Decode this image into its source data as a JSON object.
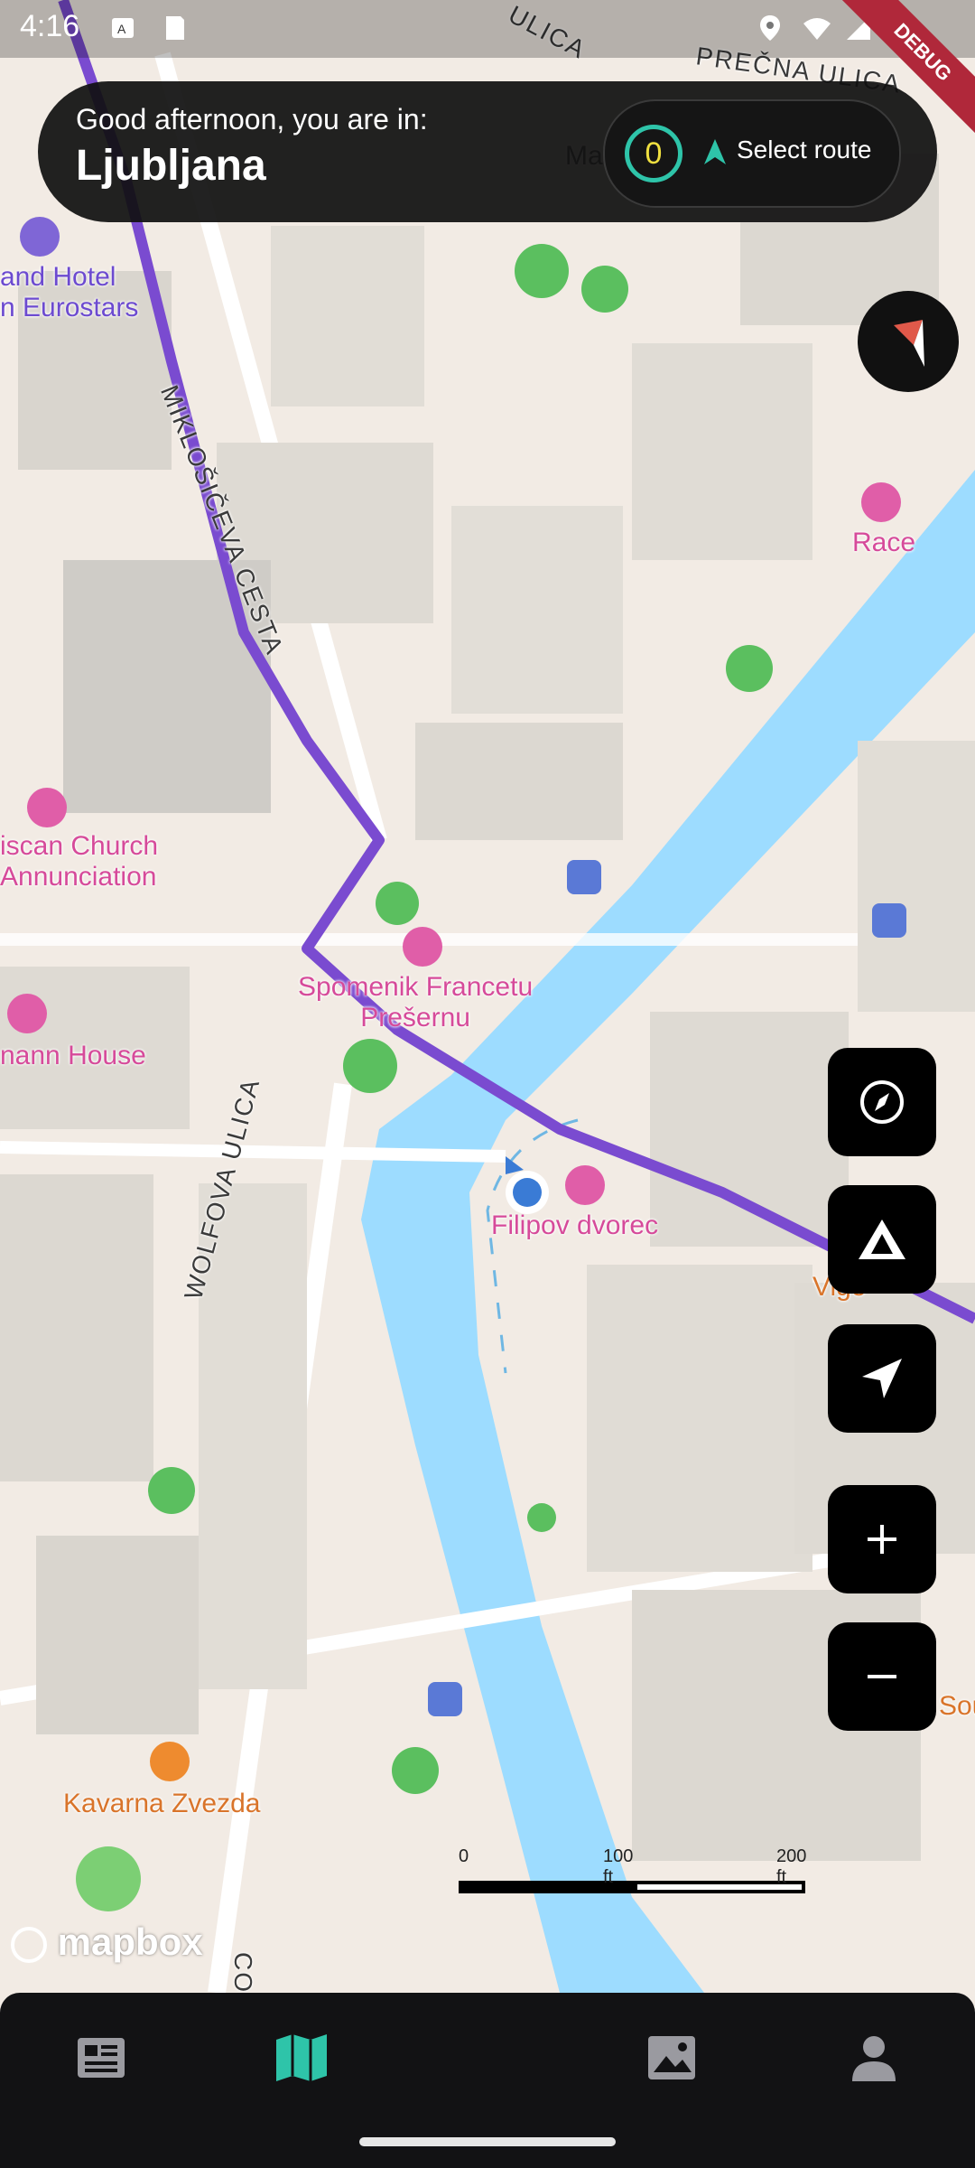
{
  "status_bar": {
    "time": "4:16",
    "debug_label": "DEBUG"
  },
  "header": {
    "greeting": "Good afternoon, you are in:",
    "city": "Ljubljana",
    "route_count": "0",
    "route_label": "Select route"
  },
  "map": {
    "streets": [
      "MIKLOŠIČEVA CESTA",
      "WOLFOVA ULICA",
      "PREČNA ULICA",
      "ULICA",
      "CO"
    ],
    "pois": {
      "hotel": "and Hotel\nn Eurostars",
      "church": "iscan Church\nAnnunciation",
      "house": "nann House",
      "monument": "Spomenik Francetu\nPrešernu",
      "filipov": "Filipov dvorec",
      "race": "Race",
      "cafe": "Kavarna Zvezda",
      "vigo": "Vigo",
      "sou": "Sou",
      "ma": "Ma"
    },
    "scale": {
      "zero": "0",
      "mid": "100 ft",
      "max": "200 ft"
    },
    "attribution": "mapbox"
  },
  "colors": {
    "accent": "#2ec4a9",
    "route": "#7a4bd0",
    "water": "#9ddcff"
  }
}
